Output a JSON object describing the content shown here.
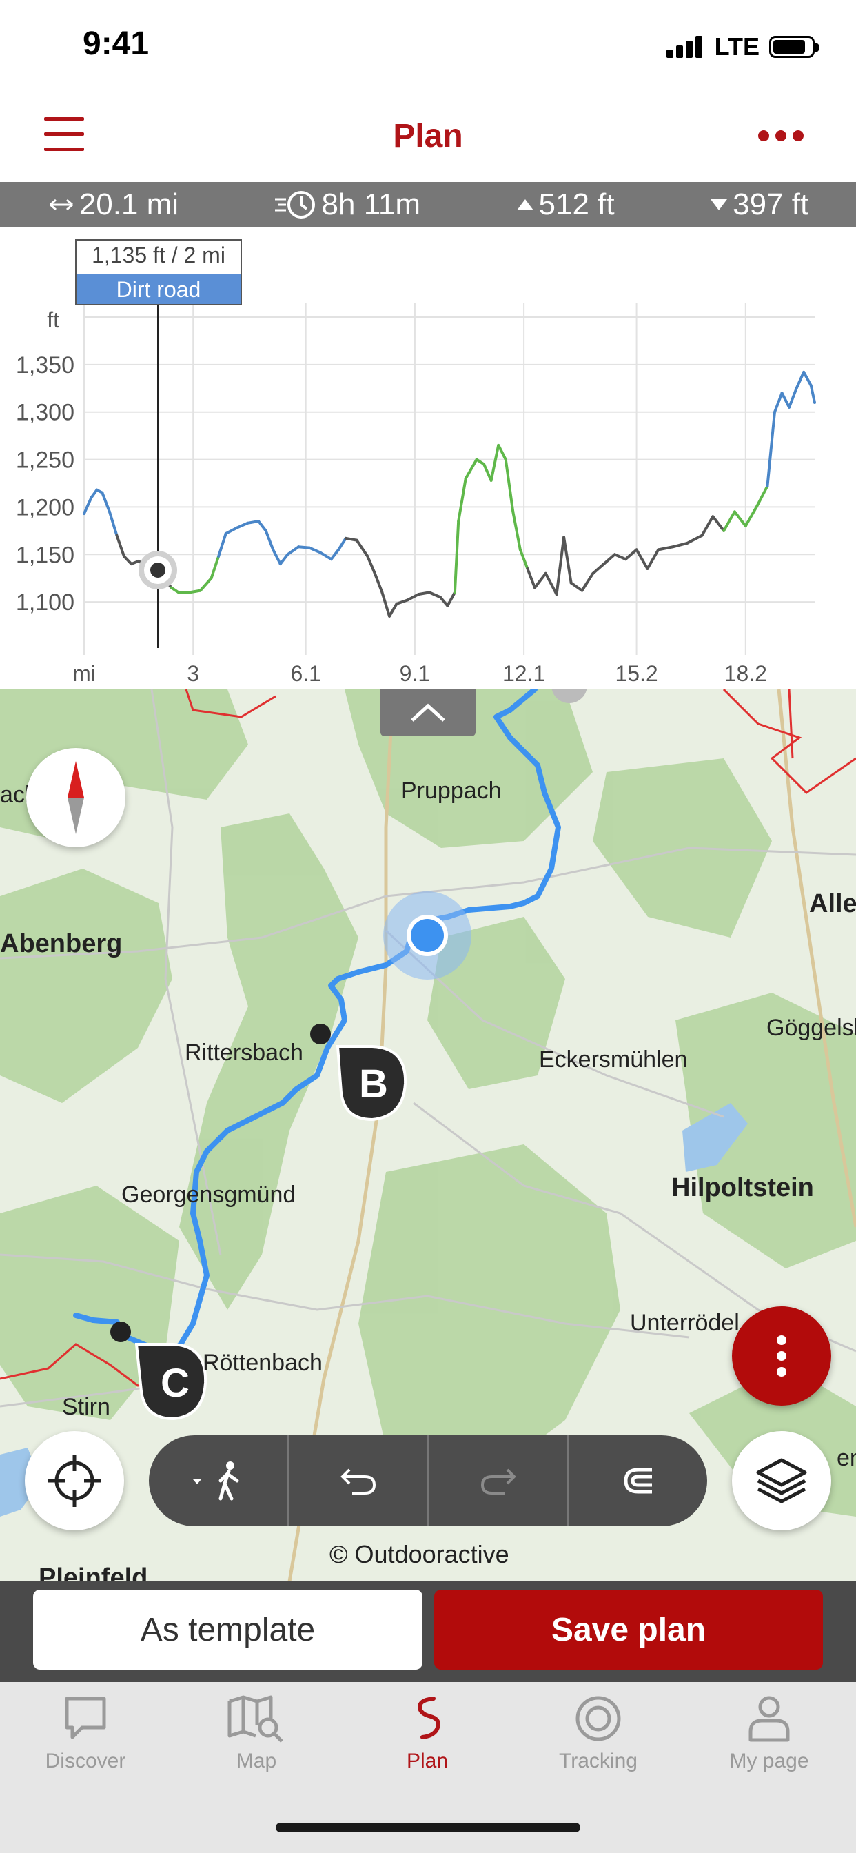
{
  "status": {
    "time": "9:41",
    "network": "LTE"
  },
  "header": {
    "title": "Plan"
  },
  "stats": {
    "distance": "20.1 mi",
    "duration": "8h 11m",
    "ascent": "512 ft",
    "descent": "397 ft"
  },
  "chart": {
    "tooltip_value": "1,135 ft / 2 mi",
    "tooltip_surface": "Dirt road",
    "y_unit": "ft",
    "x_unit": "mi",
    "y_ticks": [
      "1,350",
      "1,300",
      "1,250",
      "1,200",
      "1,150",
      "1,100"
    ],
    "x_ticks": [
      "3",
      "6.1",
      "9.1",
      "12.1",
      "15.2",
      "18.2"
    ]
  },
  "chart_data": {
    "type": "line",
    "title": "",
    "xlabel": "mi",
    "ylabel": "ft",
    "xlim": [
      0,
      20.1
    ],
    "ylim": [
      1050,
      1400
    ],
    "grid": true,
    "surface_colors": {
      "asphalt": "#4a86c8",
      "path": "#5fb84a",
      "dirt_road": "#555555",
      "unknown": "#e04040"
    },
    "series": [
      {
        "values": [
          [
            0,
            1193
          ],
          [
            0.2,
            1210
          ],
          [
            0.35,
            1218
          ],
          [
            0.5,
            1215
          ],
          [
            0.7,
            1195
          ],
          [
            0.9,
            1170
          ],
          [
            1.1,
            1148
          ],
          [
            1.3,
            1140
          ],
          [
            1.5,
            1143
          ],
          [
            1.7,
            1138
          ],
          [
            2.0,
            1135
          ],
          [
            2.2,
            1125
          ],
          [
            2.4,
            1115
          ],
          [
            2.6,
            1110
          ],
          [
            2.9,
            1110
          ],
          [
            3.2,
            1112
          ],
          [
            3.5,
            1125
          ],
          [
            3.7,
            1148
          ],
          [
            3.9,
            1172
          ],
          [
            4.2,
            1178
          ],
          [
            4.5,
            1183
          ],
          [
            4.8,
            1185
          ],
          [
            5.0,
            1175
          ],
          [
            5.2,
            1155
          ],
          [
            5.4,
            1140
          ],
          [
            5.6,
            1150
          ],
          [
            5.9,
            1158
          ],
          [
            6.2,
            1157
          ],
          [
            6.5,
            1152
          ],
          [
            6.8,
            1145
          ],
          [
            7.0,
            1155
          ],
          [
            7.2,
            1167
          ],
          [
            7.5,
            1165
          ],
          [
            7.8,
            1148
          ],
          [
            8.0,
            1130
          ],
          [
            8.2,
            1110
          ],
          [
            8.4,
            1085
          ],
          [
            8.6,
            1098
          ],
          [
            8.9,
            1102
          ],
          [
            9.2,
            1108
          ],
          [
            9.5,
            1110
          ],
          [
            9.8,
            1105
          ],
          [
            10.0,
            1096
          ],
          [
            10.2,
            1110
          ],
          [
            10.3,
            1185
          ],
          [
            10.5,
            1230
          ],
          [
            10.8,
            1250
          ],
          [
            11.0,
            1245
          ],
          [
            11.2,
            1228
          ],
          [
            11.4,
            1265
          ],
          [
            11.6,
            1250
          ],
          [
            11.8,
            1195
          ],
          [
            12.0,
            1155
          ],
          [
            12.2,
            1135
          ],
          [
            12.4,
            1115
          ],
          [
            12.7,
            1130
          ],
          [
            13.0,
            1108
          ],
          [
            13.2,
            1168
          ],
          [
            13.4,
            1120
          ],
          [
            13.7,
            1112
          ],
          [
            14.0,
            1130
          ],
          [
            14.3,
            1140
          ],
          [
            14.6,
            1150
          ],
          [
            14.9,
            1145
          ],
          [
            15.2,
            1155
          ],
          [
            15.5,
            1135
          ],
          [
            15.8,
            1155
          ],
          [
            16.2,
            1158
          ],
          [
            16.6,
            1162
          ],
          [
            17.0,
            1170
          ],
          [
            17.3,
            1190
          ],
          [
            17.6,
            1175
          ],
          [
            17.9,
            1195
          ],
          [
            18.2,
            1180
          ],
          [
            18.5,
            1200
          ],
          [
            18.8,
            1222
          ],
          [
            19.0,
            1300
          ],
          [
            19.2,
            1320
          ],
          [
            19.4,
            1305
          ],
          [
            19.6,
            1325
          ],
          [
            19.8,
            1342
          ],
          [
            20.0,
            1328
          ],
          [
            20.1,
            1310
          ]
        ]
      }
    ]
  },
  "map": {
    "places": [
      {
        "name": "Pruppach",
        "bold": false
      },
      {
        "name": "Abenberg",
        "bold": true
      },
      {
        "name": "Aller",
        "bold": true
      },
      {
        "name": "Rittersbach",
        "bold": false
      },
      {
        "name": "Eckersmühlen",
        "bold": false
      },
      {
        "name": "Göggelsbu",
        "bold": false
      },
      {
        "name": "Georgensgmünd",
        "bold": false
      },
      {
        "name": "Hilpoltstein",
        "bold": true
      },
      {
        "name": "Unterrödel",
        "bold": false
      },
      {
        "name": "Röttenbach",
        "bold": false
      },
      {
        "name": "Stirn",
        "bold": false
      },
      {
        "name": "ach",
        "bold": false
      },
      {
        "name": "Pleinfeld",
        "bold": true
      },
      {
        "name": "en",
        "bold": false
      }
    ],
    "waypoints": [
      "B",
      "C"
    ],
    "attribution": "© Outdooractive"
  },
  "actions": {
    "template_label": "As template",
    "save_label": "Save plan"
  },
  "tabs": [
    {
      "label": "Discover",
      "icon": "chat-bubble-icon"
    },
    {
      "label": "Map",
      "icon": "map-search-icon"
    },
    {
      "label": "Plan",
      "icon": "route-icon",
      "active": true
    },
    {
      "label": "Tracking",
      "icon": "target-icon"
    },
    {
      "label": "My page",
      "icon": "person-icon"
    }
  ],
  "colors": {
    "accent": "#b01418",
    "route": "#3d92f0",
    "stats_bg": "#777777"
  }
}
